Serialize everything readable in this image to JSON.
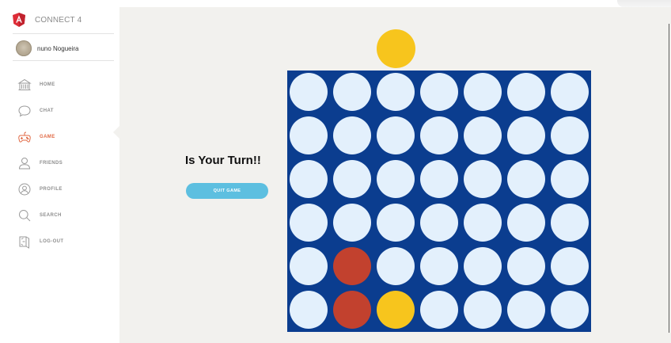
{
  "app": {
    "title": "CONNECT 4",
    "user_name": "nuno Nogueira"
  },
  "nav": [
    {
      "label": "HOME",
      "icon": "home-icon",
      "active": false
    },
    {
      "label": "CHAT",
      "icon": "chat-icon",
      "active": false
    },
    {
      "label": "GAME",
      "icon": "game-icon",
      "active": true
    },
    {
      "label": "FRIENDS",
      "icon": "friends-icon",
      "active": false
    },
    {
      "label": "PROFILE",
      "icon": "profile-icon",
      "active": false
    },
    {
      "label": "SEARCH",
      "icon": "search-icon",
      "active": false
    },
    {
      "label": "LOG-OUT",
      "icon": "logout-icon",
      "active": false
    }
  ],
  "game": {
    "status": "Is Your Turn!!",
    "quit_label": "QUIT GAME",
    "current_disc": "yellow",
    "board": [
      [
        "empty",
        "empty",
        "empty",
        "empty",
        "empty",
        "empty",
        "empty"
      ],
      [
        "empty",
        "empty",
        "empty",
        "empty",
        "empty",
        "empty",
        "empty"
      ],
      [
        "empty",
        "empty",
        "empty",
        "empty",
        "empty",
        "empty",
        "empty"
      ],
      [
        "empty",
        "empty",
        "empty",
        "empty",
        "empty",
        "empty",
        "empty"
      ],
      [
        "empty",
        "red",
        "empty",
        "empty",
        "empty",
        "empty",
        "empty"
      ],
      [
        "empty",
        "red",
        "yellow",
        "empty",
        "empty",
        "empty",
        "empty"
      ]
    ]
  },
  "colors": {
    "board": "#0b3d8f",
    "empty": "#e3f0fc",
    "red": "#c2412e",
    "yellow": "#f7c51d",
    "accent": "#e16a45",
    "button": "#5dbfe0"
  }
}
